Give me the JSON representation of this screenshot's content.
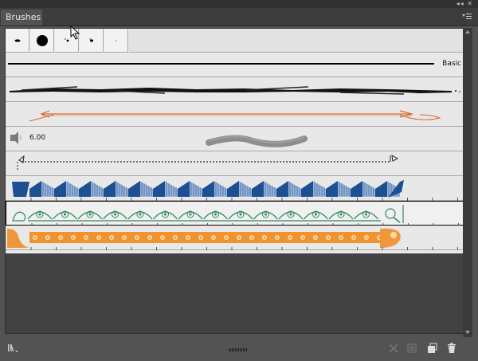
{
  "window": {
    "controls_label": "◂◂  ✕"
  },
  "tab": {
    "label": "Brushes"
  },
  "brush_rows": [
    {
      "name": "Basic",
      "label": "Basic"
    },
    {
      "name": "Charcoal"
    },
    {
      "name": "Decorative Arrow"
    },
    {
      "name": "Bristle",
      "size_label": "6.00"
    },
    {
      "name": "Dashed Arrow"
    },
    {
      "name": "Blue Pattern"
    },
    {
      "name": "Green Pattern",
      "selected": true
    },
    {
      "name": "Orange Pattern"
    }
  ],
  "thumbnails": [
    "calligraphic-1",
    "round-dot",
    "scatter-1",
    "scatter-2",
    "tiny-dot"
  ],
  "footer": {
    "icons": [
      "brush-libraries-menu-icon",
      "remove-brush-stroke-icon",
      "brush-options-icon",
      "new-brush-icon",
      "delete-brush-icon"
    ]
  },
  "colors": {
    "blue": "#1d4f93",
    "green": "#2b8a5e",
    "orange": "#ee8a1c",
    "orange_line": "#d96a2b"
  }
}
